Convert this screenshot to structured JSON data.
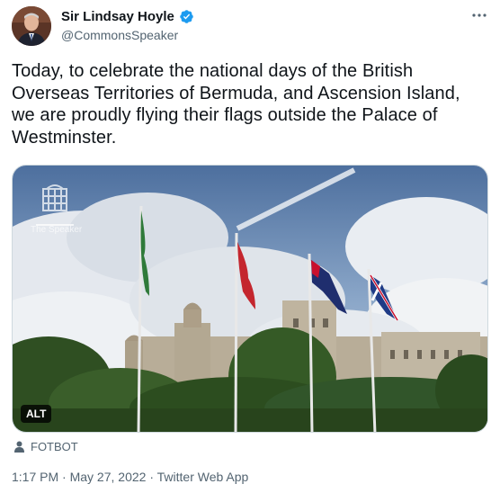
{
  "author": {
    "name": "Sir Lindsay Hoyle",
    "handle": "@CommonsSpeaker",
    "verified": true
  },
  "tweet": {
    "text": "Today, to celebrate the national days of the British Overseas Territories of Bermuda, and Ascension Island, we are proudly flying their flags outside the Palace of Westminster."
  },
  "media": {
    "alt_label": "ALT",
    "watermark_text": "The Speaker"
  },
  "tagged": {
    "user": "FOTBOT"
  },
  "meta": {
    "time": "1:17 PM",
    "date": "May 27, 2022",
    "source": "Twitter Web App",
    "sep": " · "
  },
  "colors": {
    "verified": "#1d9bf0",
    "text_secondary": "#536471",
    "border": "#cfd9de"
  },
  "icons": {
    "verified": "verified-badge-icon",
    "more": "more-horizontal-icon",
    "person": "person-icon"
  }
}
